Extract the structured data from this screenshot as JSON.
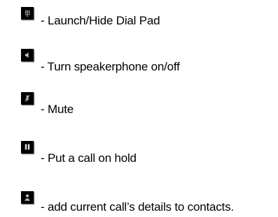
{
  "legend": {
    "items": [
      {
        "icon": "dialpad-icon",
        "text": "- Launch/Hide Dial Pad"
      },
      {
        "icon": "speaker-icon",
        "text": "- Turn speakerphone on/off"
      },
      {
        "icon": "mute-microphone-icon",
        "text": "- Mute"
      },
      {
        "icon": "pause-hold-icon",
        "text": "- Put a call on hold"
      },
      {
        "icon": "add-contact-icon",
        "text": "- add current call’s details to contacts."
      }
    ]
  },
  "colors": {
    "icon_background": "#000000",
    "icon_glyph": "#bfbfbf",
    "text": "#000000",
    "page_background": "#ffffff"
  }
}
